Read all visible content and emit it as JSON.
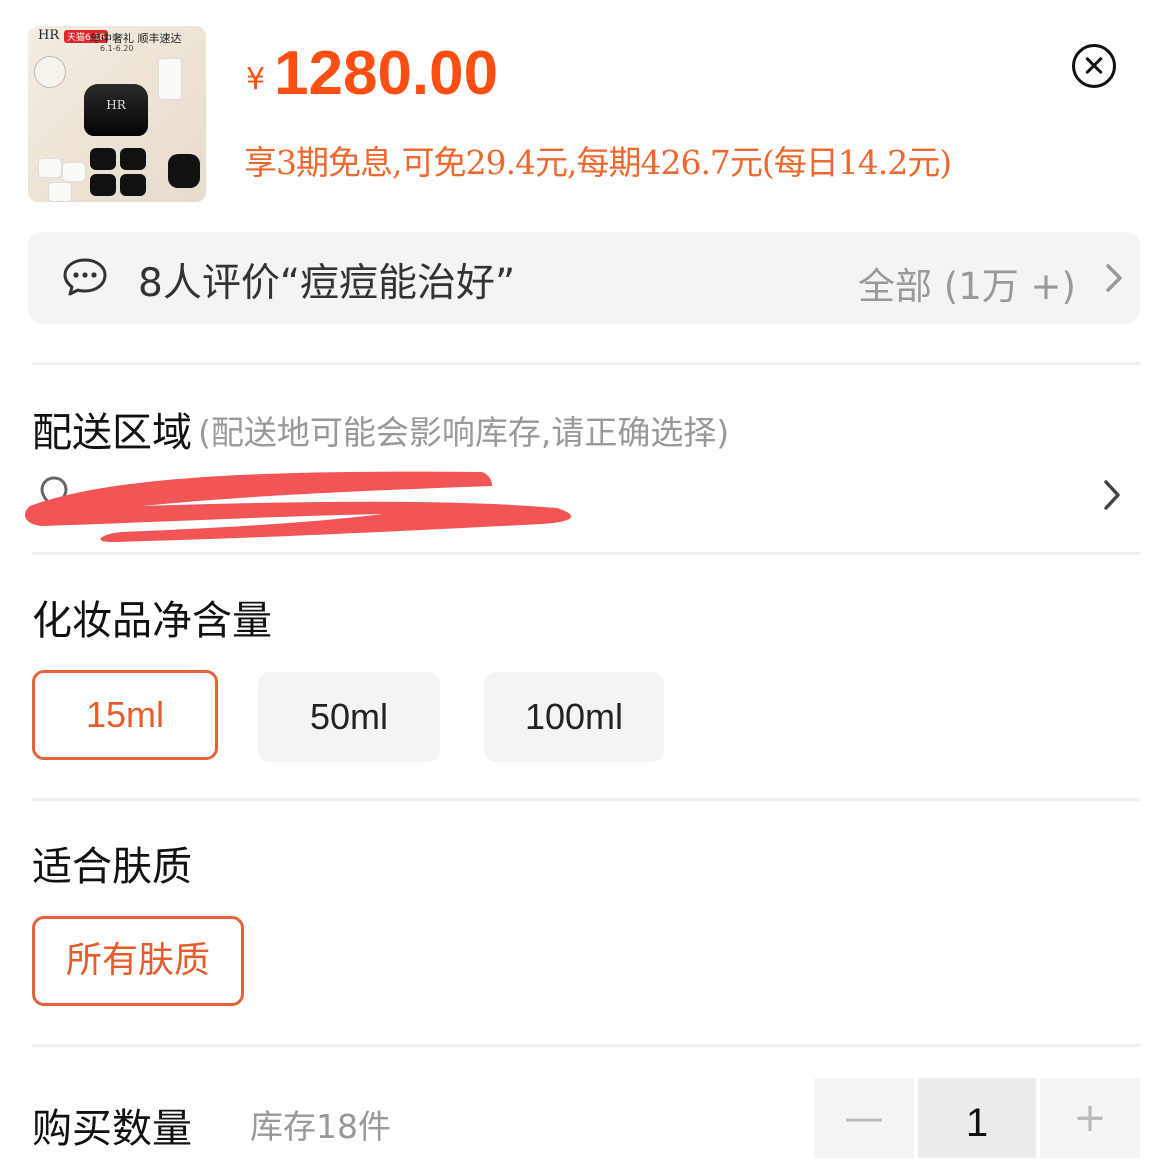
{
  "product": {
    "thumbnail": {
      "brand": "HR",
      "promo_tag": "天猫6.18",
      "headline": "年中奢礼 顺丰速达",
      "dates": "6.1-6.20"
    },
    "price_symbol": "¥",
    "price": "1280.00",
    "installment_text": "享3期免息,可免29.4元,每期426.7元(每日14.2元)"
  },
  "close_icon": "close-circle-icon",
  "reviews": {
    "summary": "8人评价“痘痘能治好”",
    "all_label": "全部 (1万 +)"
  },
  "delivery": {
    "title": "配送区域",
    "hint": "(配送地可能会影响库存,请正确选择)",
    "address_redacted": true
  },
  "volume": {
    "title": "化妆品净含量",
    "options": [
      "15ml",
      "50ml",
      "100ml"
    ],
    "selected": "15ml"
  },
  "skin": {
    "title": "适合肤质",
    "options": [
      "所有肤质"
    ],
    "selected": "所有肤质"
  },
  "quantity": {
    "title": "购买数量",
    "stock": "库存18件",
    "minus": "—",
    "value": "1",
    "plus": "+"
  },
  "colors": {
    "accent": "#ff4e12",
    "installment": "#f0682e",
    "chip_border": "#e6633a",
    "redaction": "#f25555"
  }
}
